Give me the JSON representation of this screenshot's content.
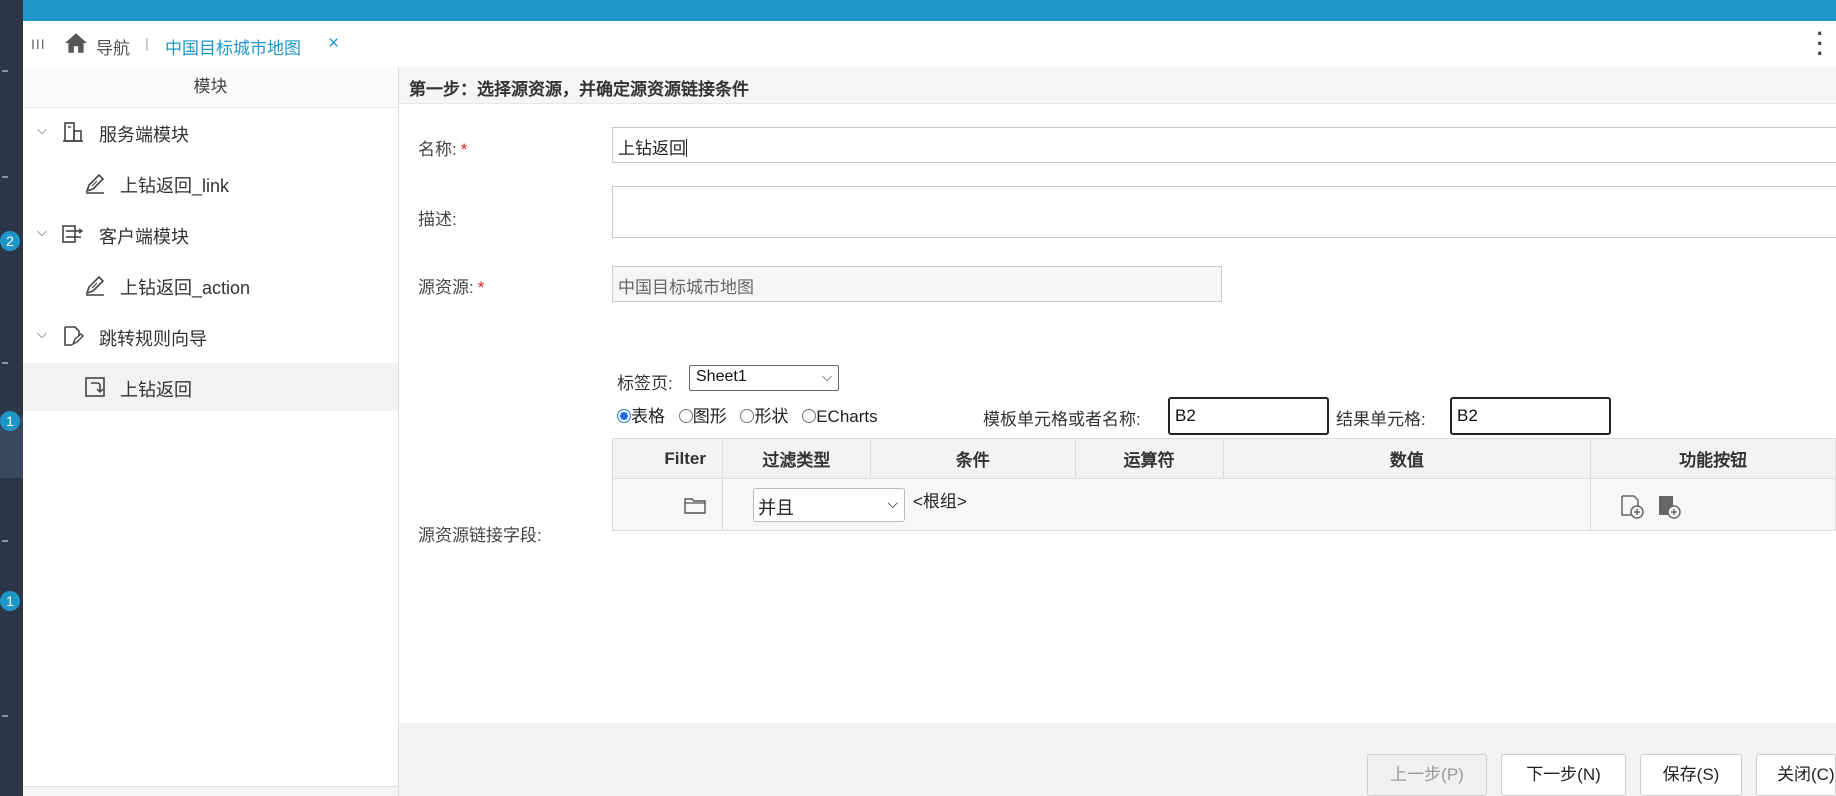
{
  "tabbar": {
    "menu_glyph": "III",
    "nav_label": "导航",
    "separator": "|",
    "active_tab": "中国目标城市地图",
    "close_glyph": "×",
    "more_glyph": "⋮"
  },
  "left_strip": {
    "badges": [
      "2",
      "1",
      "1"
    ]
  },
  "sidebar": {
    "header": "模块",
    "items": [
      {
        "label": "服务端模块",
        "icon": "server-module-icon",
        "expanded": true
      },
      {
        "label": "上钻返回_link",
        "icon": "link-edit-icon"
      },
      {
        "label": "客户端模块",
        "icon": "client-module-icon",
        "expanded": true
      },
      {
        "label": "上钻返回_action",
        "icon": "action-edit-icon"
      },
      {
        "label": "跳转规则向导",
        "icon": "jump-rule-icon",
        "expanded": true
      },
      {
        "label": "上钻返回",
        "icon": "return-arrow-icon",
        "selected": true
      }
    ]
  },
  "form": {
    "step_title": "第一步：选择源资源，并确定源资源链接条件",
    "name_label": "名称:",
    "name_value": "上钻返回",
    "desc_label": "描述:",
    "desc_value": "",
    "source_label": "源资源:",
    "source_value": "中国目标城市地图",
    "required_mark": "*",
    "link_field_label": "源资源链接字段:",
    "sheet_label": "标签页:",
    "sheet_value": "Sheet1",
    "radios": [
      "表格",
      "图形",
      "形状",
      "ECharts"
    ],
    "radio_selected": "表格",
    "template_cell_label": "模板单元格或者名称:",
    "template_cell_value": "B2",
    "result_cell_label": "结果单元格:",
    "result_cell_value": "B2"
  },
  "filter_table": {
    "headers": [
      "Filter",
      "过滤类型",
      "条件",
      "运算符",
      "数值",
      "功能按钮"
    ],
    "row": {
      "type_value": "并且",
      "group_text": "<根组>"
    }
  },
  "footer": {
    "prev": "上一步(P)",
    "next": "下一步(N)",
    "save": "保存(S)",
    "close": "关闭(C)"
  },
  "colors": {
    "accent": "#1e96c8",
    "required": "#e02020",
    "radio": "#1a73e8"
  }
}
